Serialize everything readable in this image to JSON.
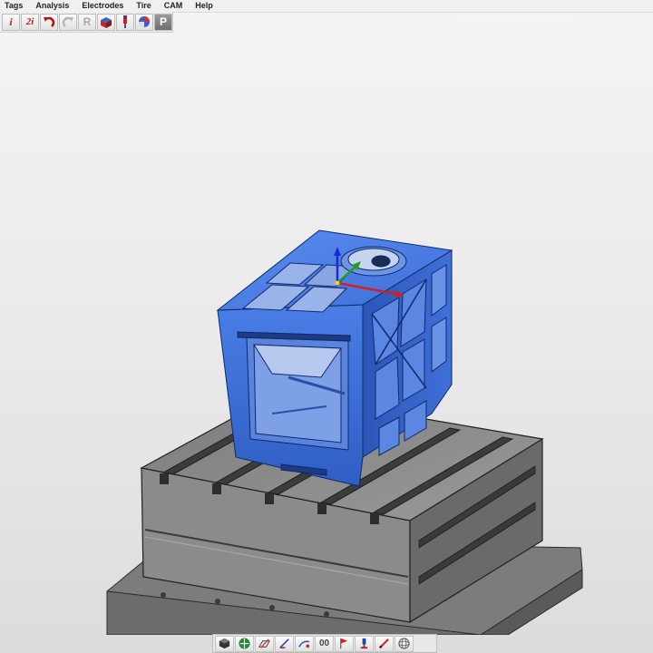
{
  "menu": [
    "Tags",
    "Analysis",
    "Electrodes",
    "Tire",
    "CAM",
    "Help"
  ],
  "toolbar": {
    "icons": [
      "i-icon",
      "2i-icon",
      "undo-icon",
      "redo-icon",
      "redo-r-icon",
      "solid-box-icon",
      "tag-pin-icon",
      "render-icon",
      "p-icon"
    ],
    "labels": {
      "i": "i",
      "two_i": "2i",
      "r": "R",
      "p": "P"
    }
  },
  "bottom_toolbar": {
    "icons": [
      "shade-icon",
      "globe-icon",
      "plane-icon",
      "axis-icon",
      "sketch-icon",
      "oo-icon",
      "flag-icon",
      "pin-icon",
      "pencil-icon",
      "sphere-icon"
    ],
    "labels": {
      "oo": "00"
    }
  },
  "colors": {
    "part_blue": "#3a6fd6",
    "part_blue_dark": "#234ea8",
    "table_gray": "#8a8a8a",
    "table_dark": "#555555"
  }
}
